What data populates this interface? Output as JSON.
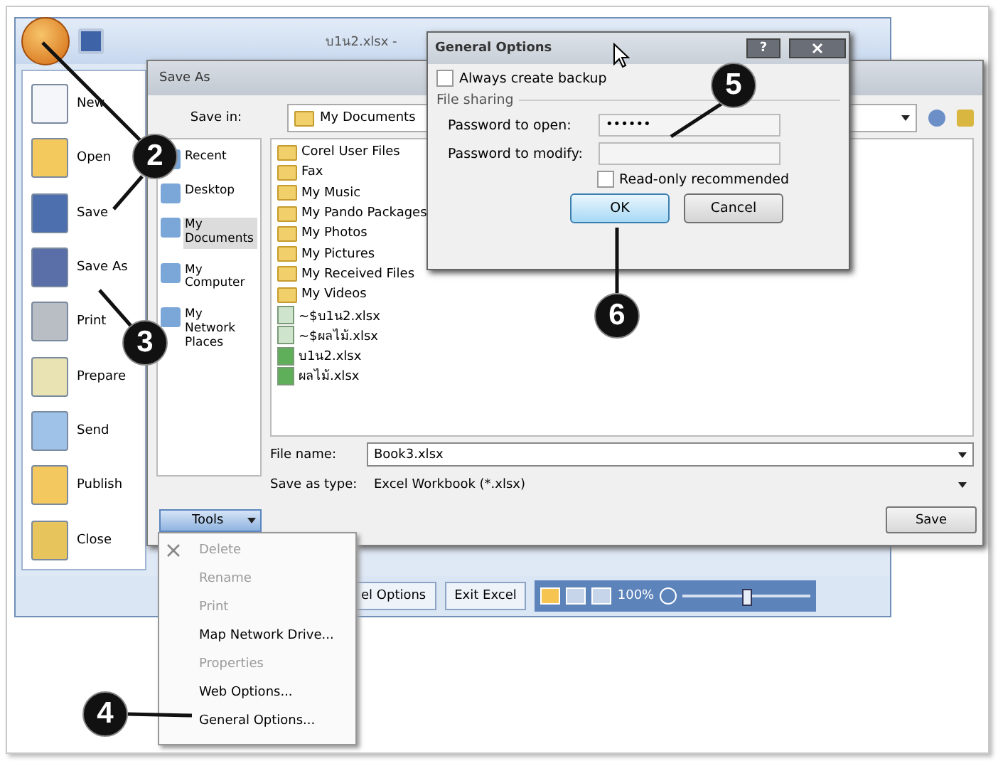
{
  "excel": {
    "title": "บ1น2.xlsx -"
  },
  "office_menu": [
    {
      "label": "New"
    },
    {
      "label": "Open"
    },
    {
      "label": "Save"
    },
    {
      "label": "Save As"
    },
    {
      "label": "Print"
    },
    {
      "label": "Prepare"
    },
    {
      "label": "Send"
    },
    {
      "label": "Publish"
    },
    {
      "label": "Close"
    }
  ],
  "menu_footer": {
    "buttons": [
      "el Options",
      "Exit Excel"
    ],
    "zoom": "100%",
    "zoom_slider": {
      "level": 0.5
    }
  },
  "save_as": {
    "title": "Save As",
    "save_in_label": "Save in:",
    "save_in_value": "My Documents",
    "places": [
      {
        "label": "Recent",
        "selected": false
      },
      {
        "label": "Desktop",
        "selected": false
      },
      {
        "label": "My Documents",
        "selected": true
      },
      {
        "label": "My Computer",
        "selected": false
      },
      {
        "label": "My Network Places",
        "selected": false
      }
    ],
    "files": [
      {
        "name": "Corel User Files",
        "kind": "folder"
      },
      {
        "name": "Fax",
        "kind": "folder"
      },
      {
        "name": "My Music",
        "kind": "folder"
      },
      {
        "name": "My Pando Packages",
        "kind": "folder"
      },
      {
        "name": "My Photos",
        "kind": "folder"
      },
      {
        "name": "My Pictures",
        "kind": "folder"
      },
      {
        "name": "My Received Files",
        "kind": "folder"
      },
      {
        "name": "My Videos",
        "kind": "folder"
      },
      {
        "name": "~$บ1น2.xlsx",
        "kind": "temp"
      },
      {
        "name": "~$ผลไม้.xlsx",
        "kind": "temp"
      },
      {
        "name": "บ1น2.xlsx",
        "kind": "workbook"
      },
      {
        "name": "ผลไม้.xlsx",
        "kind": "workbook"
      }
    ],
    "file_name_label": "File name:",
    "file_name": "Book3.xlsx",
    "type_label": "Save as type:",
    "type_value": "Excel Workbook (*.xlsx)",
    "tools": "Tools",
    "save": "Save"
  },
  "tools_menu": [
    {
      "label": "Delete",
      "disabled": true
    },
    {
      "label": "Rename",
      "disabled": true
    },
    {
      "label": "Print",
      "disabled": true
    },
    {
      "label": "Map Network Drive...",
      "disabled": false
    },
    {
      "label": "Properties",
      "disabled": true
    },
    {
      "label": "Web Options...",
      "disabled": false
    },
    {
      "label": "General Options...",
      "disabled": false
    }
  ],
  "general_options": {
    "title": "General Options",
    "help": "?",
    "backup": {
      "label": "Always create backup",
      "checked": false
    },
    "group": "File sharing",
    "password_open": {
      "label": "Password to open:",
      "value": "••••••"
    },
    "password_modify": {
      "label": "Password to modify:"
    },
    "readonly": {
      "label": "Read-only recommended",
      "checked": false
    },
    "ok": "OK",
    "cancel": "Cancel"
  },
  "callouts": [
    {
      "number": "2"
    },
    {
      "number": "3"
    },
    {
      "number": "4"
    },
    {
      "number": "5"
    },
    {
      "number": "6"
    }
  ]
}
